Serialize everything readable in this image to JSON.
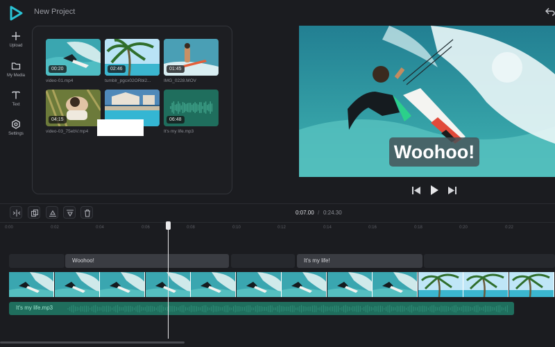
{
  "header": {
    "project_title": "New Project",
    "accent_color": "#2ac3d5"
  },
  "sidebar": {
    "items": [
      {
        "label": "Upload",
        "icon": "plus-icon"
      },
      {
        "label": "My Media",
        "icon": "folder-icon"
      },
      {
        "label": "Text",
        "icon": "text-icon"
      },
      {
        "label": "Settings",
        "icon": "gear-icon"
      }
    ]
  },
  "media": {
    "items": [
      {
        "name": "video-01.mp4",
        "duration": "00:20",
        "type": "video"
      },
      {
        "name": "tumblr_pgcx02ORbl2...",
        "duration": "02:46",
        "type": "video"
      },
      {
        "name": "IMG_0228.MOV",
        "duration": "01:45",
        "type": "video"
      },
      {
        "name": "video-03_75ebV.mp4",
        "duration": "04:15",
        "type": "video"
      },
      {
        "name": "",
        "duration": "",
        "type": "video"
      },
      {
        "name": "It's my life.mp3",
        "duration": "06:48",
        "type": "audio"
      }
    ],
    "audio_color": "#1f6e5d"
  },
  "preview": {
    "caption": "Woohoo!"
  },
  "timeline": {
    "current_time": "0:07.00",
    "separator": "/",
    "total_time": "0:24.30",
    "tools": [
      "split-icon",
      "duplicate-icon",
      "align-icon",
      "caption-icon",
      "trash-icon"
    ],
    "ruler_ticks": [
      "0:00",
      "0:02",
      "0:04",
      "0:06",
      "0:08",
      "0:10",
      "0:12",
      "0:14",
      "0:16",
      "0:18",
      "0:20",
      "0:22"
    ],
    "text_clips": [
      "Woohoo!",
      "It's my life!"
    ],
    "audio_clip": "It's my life.mp3"
  }
}
